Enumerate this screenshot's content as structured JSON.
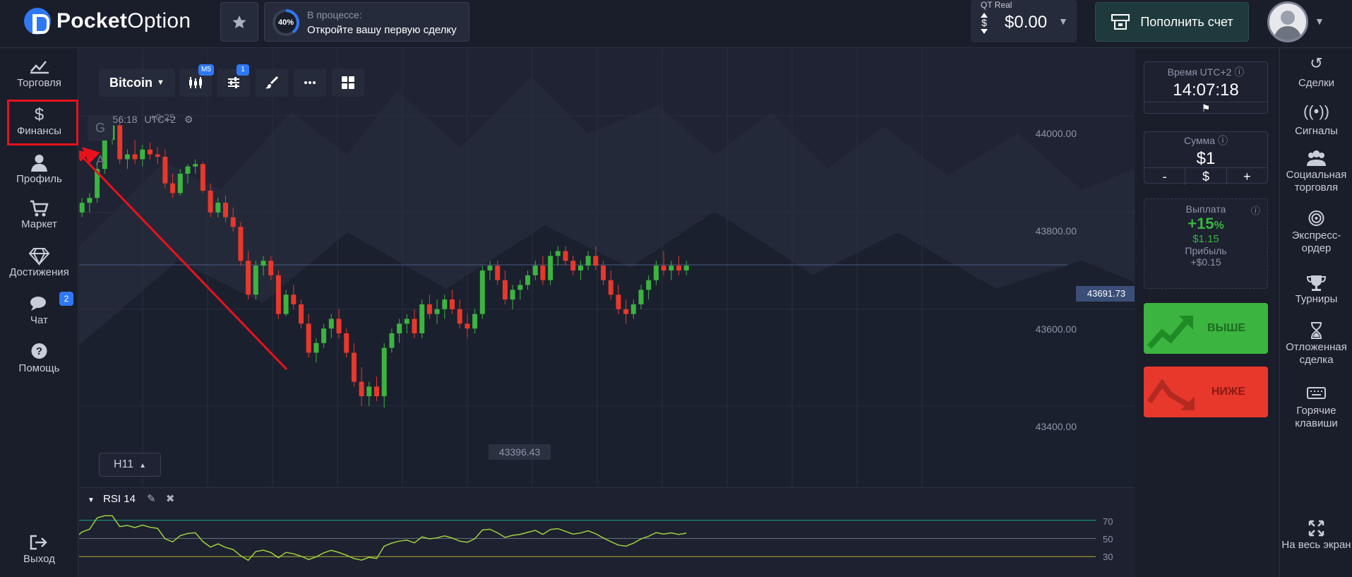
{
  "brand": {
    "name_bold": "Pocket",
    "name_light": "Option"
  },
  "progress": {
    "percent": "40%",
    "percent_value": 40,
    "status": "В процессе:",
    "task": "Откройте вашу первую сделку"
  },
  "account": {
    "type": "QT Real",
    "balance": "$0.00"
  },
  "deposit": {
    "label": "Пополнить счет"
  },
  "left_nav": {
    "items": [
      {
        "label": "Торговля",
        "icon": "chart-line-icon"
      },
      {
        "label": "Финансы",
        "icon": "dollar-icon"
      },
      {
        "label": "Профиль",
        "icon": "user-icon"
      },
      {
        "label": "Маркет",
        "icon": "cart-icon"
      },
      {
        "label": "Достижения",
        "icon": "diamond-icon"
      },
      {
        "label": "Чат",
        "icon": "chat-icon",
        "badge": "2"
      },
      {
        "label": "Помощь",
        "icon": "help-icon"
      },
      {
        "label": "Выход",
        "icon": "logout-icon"
      }
    ]
  },
  "chart": {
    "asset": "Bitcoin",
    "timeframe_badge": "M5",
    "indicator_badge": "1",
    "time": "12:56:18",
    "timezone": "UTC+2",
    "timezone_overlay": "+0:25",
    "price_levels": [
      "44000.00",
      "43800.00",
      "43600.00",
      "43400.00"
    ],
    "current_price": "43691.73",
    "low_label": "43396.43",
    "timeframe_button": "H11",
    "side_letters": [
      "G",
      "A"
    ]
  },
  "chart_data": {
    "type": "candlestick",
    "ylim": [
      43350,
      44080
    ],
    "candles": [
      [
        43770,
        43810,
        43750,
        43800
      ],
      [
        43800,
        43830,
        43790,
        43820
      ],
      [
        43820,
        43840,
        43800,
        43830
      ],
      [
        43830,
        43900,
        43820,
        43890
      ],
      [
        43890,
        43960,
        43880,
        43950
      ],
      [
        43950,
        44000,
        43940,
        43980
      ],
      [
        43980,
        43990,
        43900,
        43910
      ],
      [
        43910,
        43930,
        43890,
        43920
      ],
      [
        43920,
        43950,
        43900,
        43910
      ],
      [
        43910,
        43940,
        43895,
        43930
      ],
      [
        43930,
        43945,
        43910,
        43920
      ],
      [
        43920,
        43935,
        43900,
        43915
      ],
      [
        43915,
        43930,
        43850,
        43860
      ],
      [
        43860,
        43880,
        43830,
        43840
      ],
      [
        43840,
        43890,
        43835,
        43880
      ],
      [
        43880,
        43900,
        43860,
        43895
      ],
      [
        43895,
        43910,
        43880,
        43900
      ],
      [
        43900,
        43905,
        43840,
        43845
      ],
      [
        43845,
        43860,
        43790,
        43800
      ],
      [
        43800,
        43830,
        43790,
        43820
      ],
      [
        43820,
        43835,
        43780,
        43790
      ],
      [
        43790,
        43810,
        43760,
        43770
      ],
      [
        43770,
        43780,
        43690,
        43700
      ],
      [
        43700,
        43720,
        43620,
        43630
      ],
      [
        43630,
        43700,
        43620,
        43690
      ],
      [
        43690,
        43710,
        43670,
        43700
      ],
      [
        43700,
        43710,
        43660,
        43670
      ],
      [
        43670,
        43680,
        43580,
        43590
      ],
      [
        43590,
        43640,
        43585,
        43630
      ],
      [
        43630,
        43650,
        43600,
        43610
      ],
      [
        43610,
        43620,
        43560,
        43570
      ],
      [
        43570,
        43590,
        43500,
        43510
      ],
      [
        43510,
        43540,
        43490,
        43530
      ],
      [
        43530,
        43570,
        43520,
        43560
      ],
      [
        43560,
        43590,
        43540,
        43580
      ],
      [
        43580,
        43600,
        43540,
        43550
      ],
      [
        43550,
        43560,
        43500,
        43510
      ],
      [
        43510,
        43530,
        43440,
        43450
      ],
      [
        43450,
        43480,
        43400,
        43420
      ],
      [
        43420,
        43450,
        43400,
        43440
      ],
      [
        43440,
        43460,
        43410,
        43420
      ],
      [
        43420,
        43530,
        43396,
        43520
      ],
      [
        43520,
        43560,
        43510,
        43550
      ],
      [
        43550,
        43580,
        43530,
        43570
      ],
      [
        43570,
        43590,
        43550,
        43580
      ],
      [
        43580,
        43600,
        43540,
        43550
      ],
      [
        43550,
        43620,
        43540,
        43610
      ],
      [
        43610,
        43630,
        43580,
        43590
      ],
      [
        43590,
        43620,
        43570,
        43600
      ],
      [
        43600,
        43630,
        43580,
        43620
      ],
      [
        43620,
        43640,
        43590,
        43600
      ],
      [
        43600,
        43620,
        43560,
        43570
      ],
      [
        43570,
        43590,
        43540,
        43560
      ],
      [
        43560,
        43600,
        43550,
        43590
      ],
      [
        43590,
        43690,
        43580,
        43680
      ],
      [
        43680,
        43700,
        43660,
        43690
      ],
      [
        43690,
        43700,
        43650,
        43660
      ],
      [
        43660,
        43680,
        43610,
        43620
      ],
      [
        43620,
        43650,
        43600,
        43640
      ],
      [
        43640,
        43660,
        43620,
        43650
      ],
      [
        43650,
        43680,
        43640,
        43670
      ],
      [
        43670,
        43700,
        43660,
        43690
      ],
      [
        43690,
        43710,
        43650,
        43660
      ],
      [
        43660,
        43720,
        43650,
        43710
      ],
      [
        43710,
        43730,
        43690,
        43720
      ],
      [
        43720,
        43730,
        43690,
        43700
      ],
      [
        43700,
        43710,
        43670,
        43680
      ],
      [
        43680,
        43700,
        43660,
        43690
      ],
      [
        43690,
        43720,
        43680,
        43710
      ],
      [
        43710,
        43730,
        43680,
        43690
      ],
      [
        43690,
        43700,
        43650,
        43660
      ],
      [
        43660,
        43680,
        43620,
        43630
      ],
      [
        43630,
        43650,
        43590,
        43600
      ],
      [
        43600,
        43620,
        43570,
        43590
      ],
      [
        43590,
        43620,
        43580,
        43610
      ],
      [
        43610,
        43650,
        43600,
        43640
      ],
      [
        43640,
        43670,
        43620,
        43660
      ],
      [
        43660,
        43700,
        43650,
        43690
      ],
      [
        43690,
        43720,
        43670,
        43680
      ],
      [
        43680,
        43700,
        43660,
        43690
      ],
      [
        43690,
        43710,
        43670,
        43680
      ],
      [
        43680,
        43700,
        43670,
        43690
      ]
    ]
  },
  "rsi": {
    "label": "RSI 14",
    "levels": [
      "70",
      "50",
      "30"
    ]
  },
  "trade_panel": {
    "time_label": "Время UTC+2",
    "time_value": "14:07:18",
    "amount_label": "Сумма",
    "amount_value": "$1",
    "amount_minus": "-",
    "amount_currency": "$",
    "amount_plus": "+",
    "payout_label": "Выплата",
    "payout_percent": "+15",
    "payout_percent_sign": "%",
    "payout_amount": "$1.15",
    "profit_label": "Прибыль",
    "profit_value": "+$0.15",
    "higher_label": "ВЫШЕ",
    "lower_label": "НИЖЕ"
  },
  "right_nav": {
    "items": [
      {
        "label": "Сделки",
        "icon": "history-icon"
      },
      {
        "label": "Сигналы",
        "icon": "signal-icon"
      },
      {
        "label": "Социальная торговля",
        "icon": "users-icon"
      },
      {
        "label": "Экспресс-ордер",
        "icon": "target-icon"
      },
      {
        "label": "Турниры",
        "icon": "trophy-icon"
      },
      {
        "label": "Отложенная сделка",
        "icon": "hourglass-icon"
      },
      {
        "label": "Горячие клавиши",
        "icon": "keyboard-icon"
      },
      {
        "label": "На весь экран",
        "icon": "fullscreen-icon"
      }
    ]
  },
  "colors": {
    "up": "#3bb440",
    "down": "#e8382c",
    "accent": "#2f78f4",
    "rsi": "#9fd13c"
  }
}
